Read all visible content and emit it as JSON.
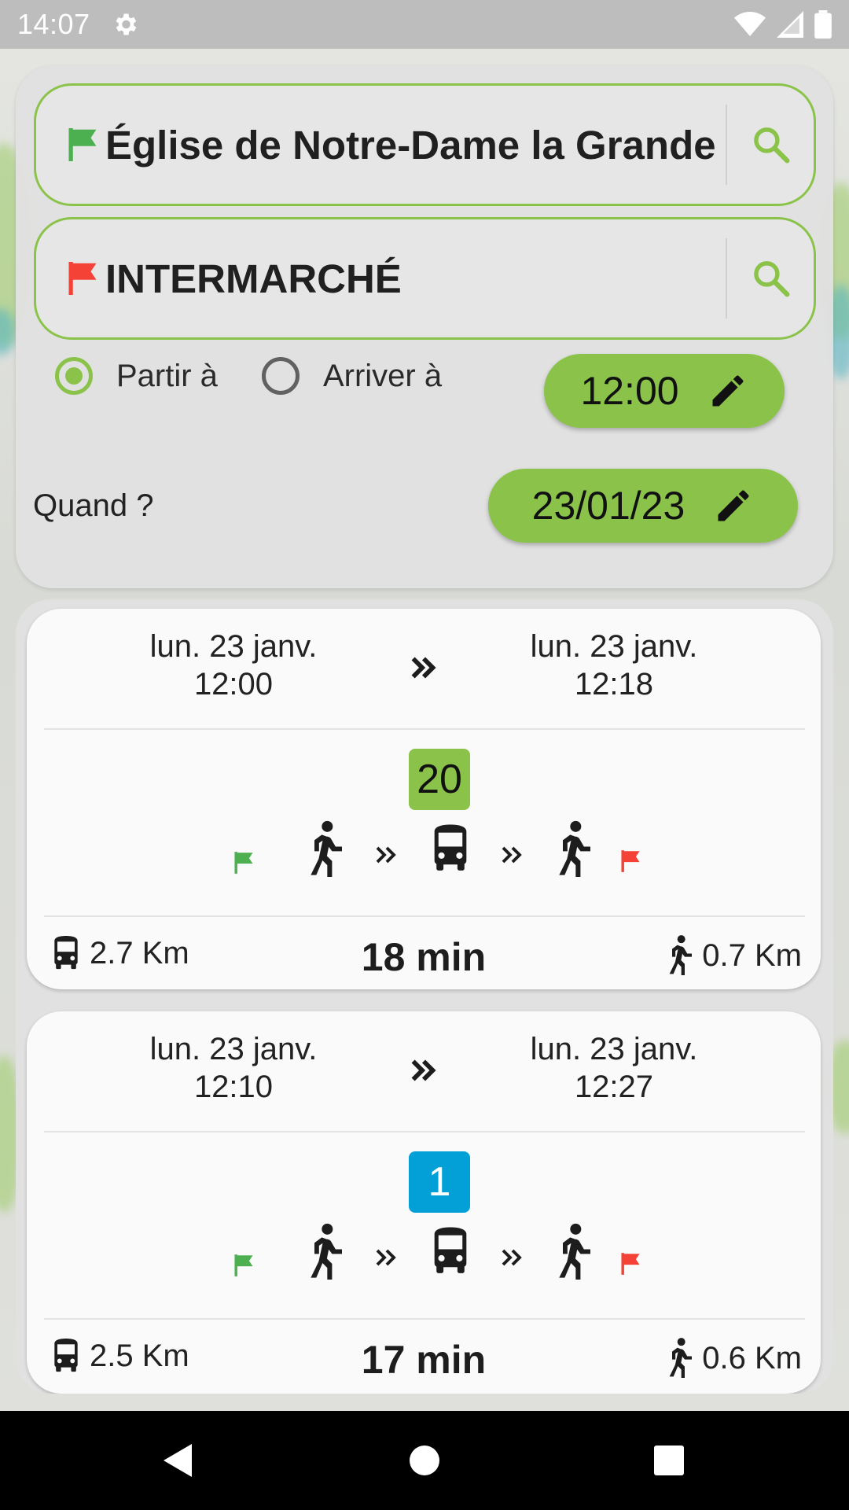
{
  "status_bar": {
    "time": "14:07",
    "icons": [
      "gear-icon",
      "wifi-icon",
      "signal-icon",
      "battery-icon"
    ]
  },
  "search": {
    "from": {
      "value": "Église de Notre-Dame la Grande",
      "icon": "green-flag-icon"
    },
    "to": {
      "value": "INTERMARCHÉ",
      "icon": "red-flag-icon"
    },
    "options": {
      "depart_label": "Partir à",
      "arrive_label": "Arriver à",
      "selected": "depart",
      "time": "12:00",
      "when_label": "Quand ?",
      "date": "23/01/23"
    }
  },
  "colors": {
    "accent": "#8bc34a",
    "line_20": "#8bc34a",
    "line_1": "#03a0d8",
    "flag_start": "#4caf50",
    "flag_end": "#f44336"
  },
  "trips": [
    {
      "departure_date": "lun. 23 janv.",
      "departure_time": "12:00",
      "arrival_date": "lun. 23 janv.",
      "arrival_time": "12:18",
      "line": "20",
      "bus_distance": "2.7 Km",
      "duration": "18 min",
      "walk_distance": "0.7 Km"
    },
    {
      "departure_date": "lun. 23 janv.",
      "departure_time": "12:10",
      "arrival_date": "lun. 23 janv.",
      "arrival_time": "12:27",
      "line": "1",
      "bus_distance": "2.5 Km",
      "duration": "17 min",
      "walk_distance": "0.6 Km"
    }
  ],
  "nav": [
    "back-icon",
    "home-icon",
    "recents-icon"
  ]
}
